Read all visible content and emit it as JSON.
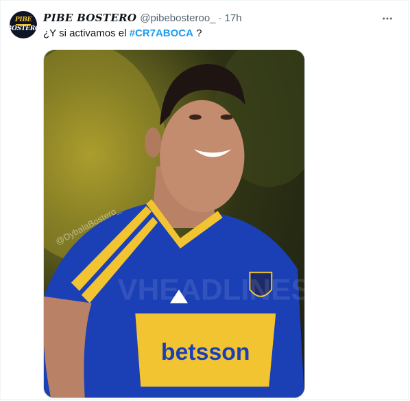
{
  "tweet": {
    "author_name": "PIBE BOSTERO",
    "handle": "@pibebosteroo_",
    "separator": "·",
    "time": "17h",
    "text_prefix": "¿Y si activamos el ",
    "hashtag": "#CR7ABOCA",
    "text_suffix": " ?",
    "avatar_lines": [
      "PIBE",
      "BOSTERO"
    ]
  },
  "media": {
    "jersey_sponsor": "betsson",
    "watermark_handle": "@DybalaBostero_",
    "watermark_text": "VHEADLINES",
    "colors": {
      "jersey_blue": "#1b3fb5",
      "jersey_gold": "#f2c431"
    }
  },
  "icons": {
    "more": "more-horizontal-icon"
  }
}
